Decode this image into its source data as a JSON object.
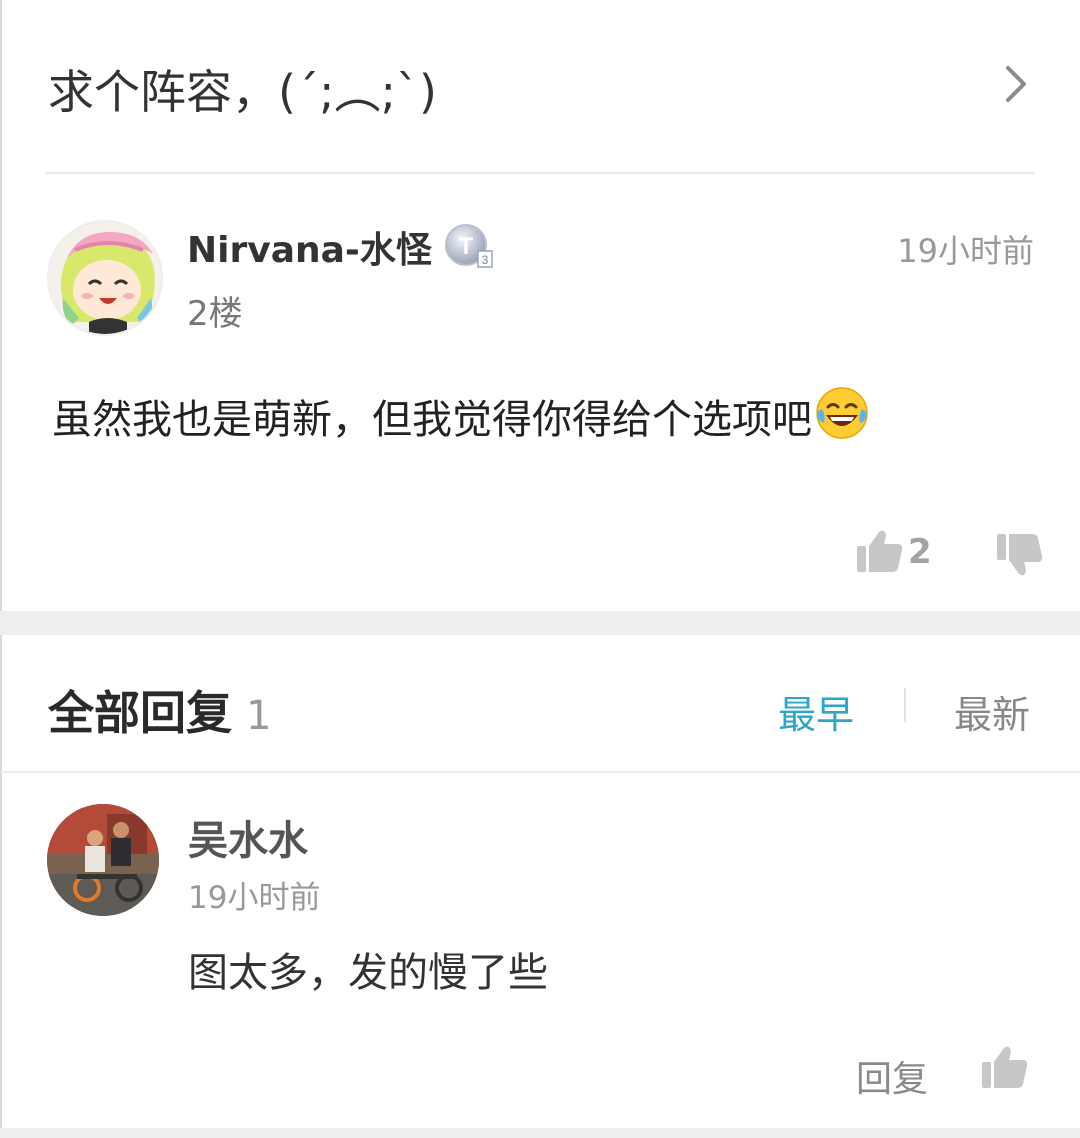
{
  "topic": {
    "title": "求个阵容，(´;︵;`)"
  },
  "post": {
    "username": "Nirvana-水怪",
    "level_badge": "T3",
    "time": "19小时前",
    "floor": "2楼",
    "content": "虽然我也是萌新，但我觉得你得给个选项吧",
    "emoji": "face-with-tears-of-joy-icon",
    "like_count": "2"
  },
  "replies": {
    "title": "全部回复",
    "count": "1",
    "sort_earliest": "最早",
    "sort_newest": "最新",
    "accent_color": "#2aa7c9",
    "items": [
      {
        "username": "吴水水",
        "time": "19小时前",
        "content": "图太多，发的慢了些",
        "reply_label": "回复"
      }
    ]
  }
}
